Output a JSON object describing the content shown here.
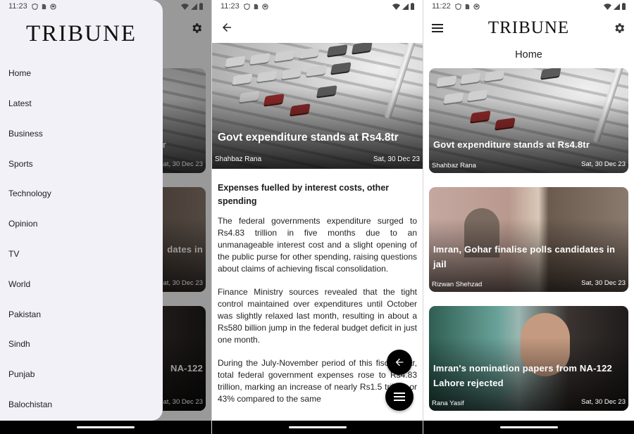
{
  "screens": {
    "drawer": {
      "status_time": "11:23",
      "logo": "TRIBUNE",
      "menu_items": [
        "Home",
        "Latest",
        "Business",
        "Sports",
        "Technology",
        "Opinion",
        "TV",
        "World",
        "Pakistan",
        "Sindh",
        "Punjab",
        "Balochistan"
      ],
      "behind_fragments": [
        "tr",
        "Sat, 30 Dec 23",
        "dates in",
        "Sat, 30 Dec 23",
        "NA-122",
        "Sat, 30 Dec 23"
      ]
    },
    "article": {
      "status_time": "11:23",
      "hero_title": "Govt expenditure stands at Rs4.8tr",
      "author": "Shahbaz Rana",
      "date": "Sat, 30 Dec 23",
      "subheading": "Expenses fuelled by interest costs, other spending",
      "paragraphs": [
        "The federal governments expenditure surged to Rs4.83 trillion in five months due to an unmanageable interest cost and a slight opening of the public purse for other spending, raising questions about claims of achieving fiscal consolidation.",
        "Finance Ministry sources revealed that the tight control maintained over expenditures until October was slightly relaxed last month, resulting in about a Rs580 billion jump in the federal budget deficit in just one month.",
        "During the July-November period of this fiscal year, total federal government expenses rose to Rs4.83 trillion, marking an increase of nearly Rs1.5 trillion or 43% compared to the same"
      ]
    },
    "home": {
      "status_time": "11:22",
      "logo": "TRIBUNE",
      "page_title": "Home",
      "cards": [
        {
          "title": "Govt expenditure stands at Rs4.8tr",
          "author": "Shahbaz Rana",
          "date": "Sat, 30 Dec 23"
        },
        {
          "title": "Imran, Gohar finalise polls candidates in jail",
          "author": "Rizwan Shehzad",
          "date": "Sat, 30 Dec 23"
        },
        {
          "title": "Imran's nomination papers from NA-122 Lahore rejected",
          "author": "Rana Yasif",
          "date": "Sat, 30 Dec 23"
        }
      ]
    }
  },
  "icons": {
    "back": "arrow-left-icon",
    "menu": "hamburger-menu-icon",
    "settings": "gear-icon",
    "fab_back": "arrow-left-icon",
    "fab_menu": "hamburger-menu-icon"
  },
  "colors": {
    "drawer_bg": "#f3f1f8",
    "fab_bg": "#000000",
    "nav_bar": "#000000"
  }
}
